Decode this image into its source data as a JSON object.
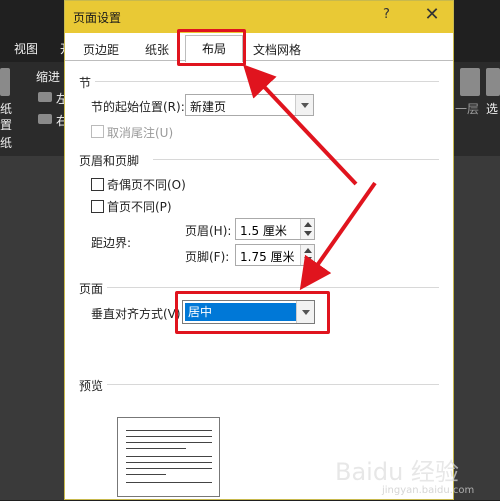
{
  "background": {
    "ribbon_left": [
      "视图",
      "开"
    ],
    "ribbon_indent": "缩进",
    "ribbon_left_items": [
      "纸",
      "置",
      "纸"
    ],
    "ribbon_mid": [
      "左",
      "右"
    ],
    "ribbon_right": [
      "一层",
      "选"
    ]
  },
  "dialog": {
    "title": "页面设置",
    "help_label": "?",
    "close_label": "✕",
    "tabs": [
      "页边距",
      "纸张",
      "布局",
      "文档网格"
    ],
    "active_tab": "布局",
    "section": {
      "label": "节",
      "start_label": "节的起始位置(R):",
      "start_value": "新建页",
      "suppress_endnotes_label": "取消尾注(U)",
      "suppress_endnotes_checked": false,
      "suppress_endnotes_disabled": true
    },
    "headers_footers": {
      "label": "页眉和页脚",
      "odd_even_label": "奇偶页不同(O)",
      "odd_even_checked": false,
      "first_page_label": "首页不同(P)",
      "first_page_checked": false,
      "from_edge_label": "距边界:",
      "header_label": "页眉(H):",
      "header_value": "1.5 厘米",
      "footer_label": "页脚(F):",
      "footer_value": "1.75 厘米"
    },
    "page": {
      "label": "页面",
      "vertical_align_label": "垂直对齐方式(V):",
      "vertical_align_value": "居中"
    },
    "preview": {
      "label": "预览"
    }
  },
  "annotations": {
    "box_color": "#e0141e"
  },
  "watermark": {
    "text": "Baidu 经验",
    "sub": "jingyan.baidu.com"
  }
}
